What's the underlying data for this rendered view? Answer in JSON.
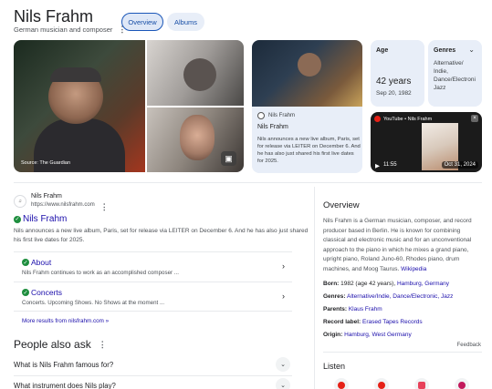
{
  "header": {
    "title": "Nils Frahm",
    "subtitle": "German musician and composer",
    "tabs": [
      {
        "label": "Overview",
        "selected": true
      },
      {
        "label": "Albums",
        "selected": false
      }
    ]
  },
  "images": {
    "main_caption": "Source: The Guardian",
    "image_icon": "image-icon"
  },
  "news": {
    "source": "Nils Frahm",
    "title": "Nils Frahm",
    "snippet": "Nils announces a new live album, Paris, set for release via LEITER on December 6. And he has also just shared his first live dates for 2025."
  },
  "facts": {
    "age_label": "Age",
    "age_value": "42 years",
    "age_date": "Sep 20, 1982",
    "genres_label": "Genres",
    "genres_value": "Alternative/ Indie, Dance/Electroni Jazz"
  },
  "video": {
    "source": "YouTube • Nils Frahm",
    "duration": "11:55",
    "date": "Oct 31, 2024"
  },
  "result": {
    "site_name": "Nils Frahm",
    "site_url": "https://www.nilsfrahm.com",
    "title": "Nils Frahm",
    "snippet": "Nils announces a new live album, Paris, set for release via LEITER on December 6. And he has also just shared his first live dates for 2025.",
    "sublinks": [
      {
        "title": "About",
        "desc": "Nils Frahm continues to work as an accomplished composer ..."
      },
      {
        "title": "Concerts",
        "desc": "Concerts. Upcoming Shows. No Shows at the moment ..."
      }
    ],
    "more": "More results from nilsfrahm.com »"
  },
  "paa": {
    "title": "People also ask",
    "questions": [
      "What is Nils Frahm famous for?",
      "What instrument does Nils play?"
    ]
  },
  "overview": {
    "title": "Overview",
    "description": "Nils Frahm is a German musician, composer, and record producer based in Berlin. He is known for combining classical and electronic music and for an unconventional approach to the piano in which he mixes a grand piano, upright piano, Roland Juno-60, Rhodes piano, drum machines, and Moog Taurus.",
    "wiki_link": "Wikipedia",
    "facts": [
      {
        "label": "Born:",
        "value": "1982 (age 42 years),",
        "link": "Hamburg, Germany"
      },
      {
        "label": "Genres:",
        "value": "",
        "link": "Alternative/Indie, Dance/Electronic, Jazz"
      },
      {
        "label": "Parents:",
        "value": "",
        "link": "Klaus Frahm"
      },
      {
        "label": "Record label:",
        "value": "",
        "link": "Erased Tapes Records"
      },
      {
        "label": "Origin:",
        "value": "",
        "link": "Hamburg, West Germany"
      }
    ],
    "feedback": "Feedback",
    "listen_title": "Listen"
  },
  "colors": {
    "accent": "#1a0dab",
    "chip_bg": "#e8eef8",
    "check": "#1e8e3e"
  }
}
